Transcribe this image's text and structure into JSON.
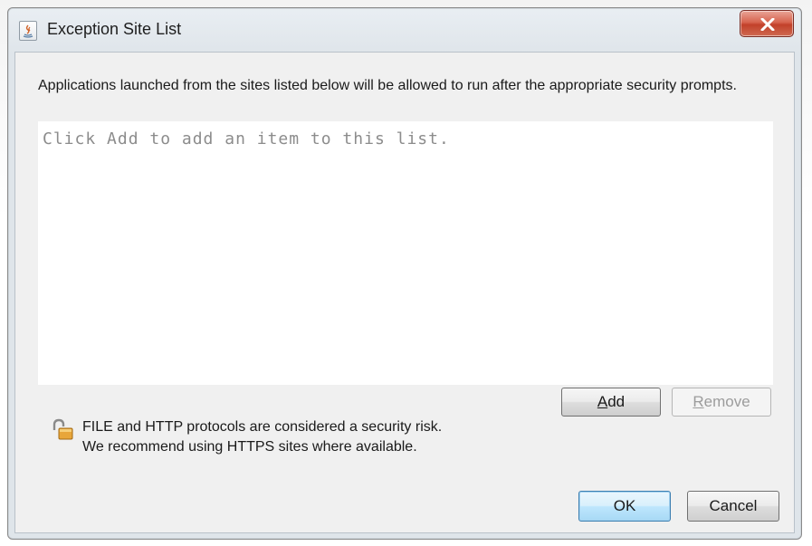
{
  "window": {
    "title": "Exception Site List",
    "icon": "java-icon",
    "close_icon": "close-icon"
  },
  "description": "Applications launched from the sites listed below will be allowed to run after the appropriate security prompts.",
  "site_list": {
    "placeholder": "Click Add to add an item to this list.",
    "items": []
  },
  "list_buttons": {
    "add": {
      "mnemonic": "A",
      "rest": "dd",
      "enabled": true
    },
    "remove": {
      "mnemonic": "R",
      "rest": "emove",
      "enabled": false
    }
  },
  "warning": {
    "icon": "unlocked-padlock-icon",
    "line1": "FILE and HTTP protocols are considered a security risk.",
    "line2": "We recommend using HTTPS sites where available."
  },
  "dialog_buttons": {
    "ok": "OK",
    "cancel": "Cancel"
  },
  "colors": {
    "close_button": "#c2412a",
    "ok_button_border": "#3c7fb1"
  }
}
